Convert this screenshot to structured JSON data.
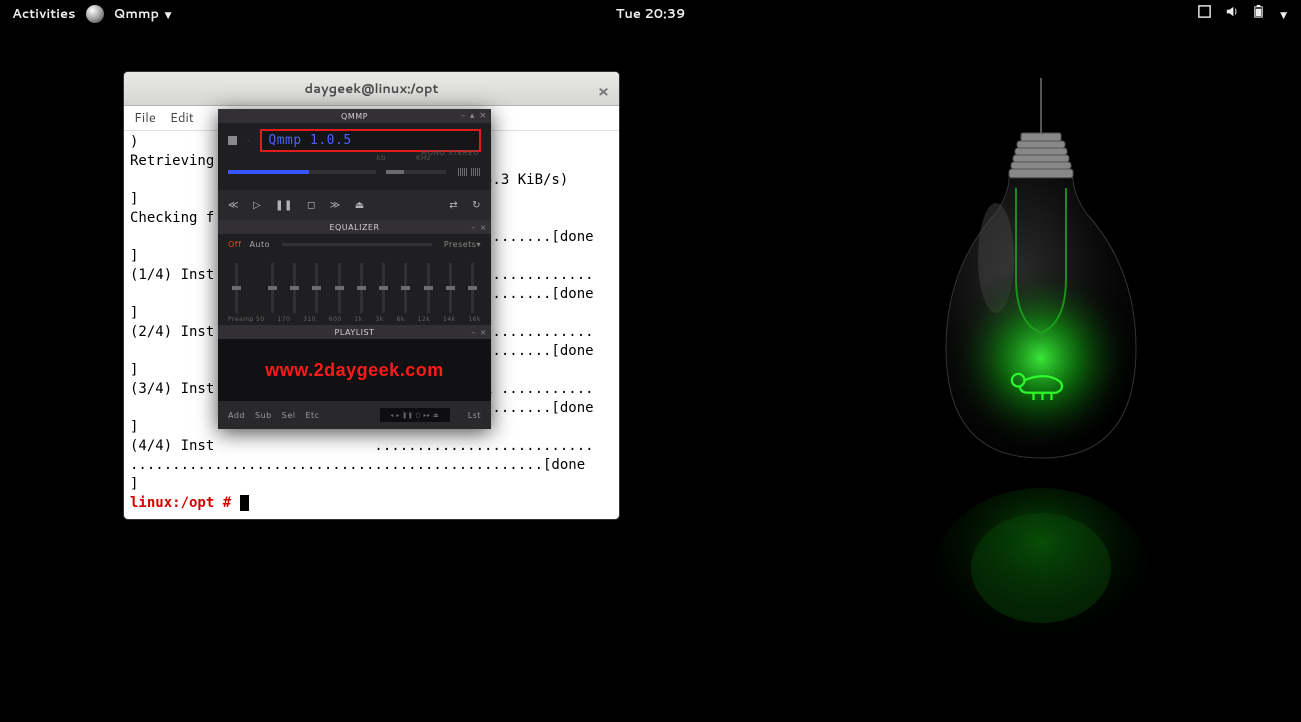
{
  "topbar": {
    "activities": "Activities",
    "app_name": "Qmmp",
    "clock": "Tue 20:39"
  },
  "terminal": {
    "title": "daygeek@linux:/opt",
    "menu": {
      "file": "File",
      "edit": "Edit"
    },
    "lines": {
      "l1": ")",
      "l2": "Retrieving",
      "l3": "                                      e (55.3 KiB/s)",
      "l4": "]",
      "l5": "Checking f",
      "l6": "                             .....................[done",
      "l7": "]",
      "l8": "(1/4) Inst                   ..........................",
      "l9": "                             .....................[done",
      "l10": "]",
      "l11": "(2/4) Inst                   ..........................",
      "l12": "                             .....................[done",
      "l13": "]",
      "l14": "(3/4) Inst                             78.1 ...........",
      "l15": "                             .....................[done",
      "l16": "]",
      "l17": "(4/4) Inst                   ..........................",
      "l18": ".................................................[done",
      "l19": "]",
      "prompt": "linux:/opt # "
    }
  },
  "qmmp": {
    "title": "QMMP",
    "display": "Qmmp 1.0.5",
    "kb": "kb",
    "khz": "KHz",
    "mono": "MONO",
    "stereo": "STEREO",
    "eq_title": "EQUALIZER",
    "eq_off": "Off",
    "eq_auto": "Auto",
    "eq_presets": "Presets▾",
    "eq_preamp": "Preamp",
    "eq_freqs": [
      "50",
      "170",
      "310",
      "600",
      "1k",
      "3k",
      "6k",
      "12k",
      "14k",
      "16k"
    ],
    "pl_title": "PLAYLIST",
    "watermark": "www.2daygeek.com",
    "pl_btns": {
      "add": "Add",
      "sub": "Sub",
      "sel": "Sel",
      "etc": "Etc",
      "lst": "Lst"
    }
  }
}
